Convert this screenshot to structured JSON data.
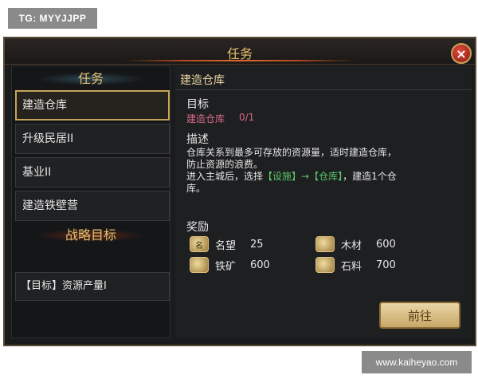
{
  "watermarks": {
    "top": "TG: MYYJJPP",
    "bottom": "www.kaiheyao.com"
  },
  "window": {
    "title": "任务",
    "close_label": "×"
  },
  "left": {
    "tasks_header": "任务",
    "tasks": [
      "建造仓库",
      "升级民居II",
      "基业II",
      "建造铁壁营"
    ],
    "strategy_header": "战略目标",
    "strategy_item": "【目标】资源产量I"
  },
  "detail": {
    "title": "建造仓库",
    "objective_label": "目标",
    "objective_name": "建造仓库",
    "objective_progress": "0/1",
    "description_label": "描述",
    "description_line1": "仓库关系到最多可存放的资源量，适时建造仓库，",
    "description_line2": "防止资源的浪费。",
    "description_line3_pre": "进入主城后，选择",
    "description_link1": "【设施】→【仓库】",
    "description_line3_post": "，建造1个仓",
    "description_line4": "库。",
    "reward_label": "奖励",
    "rewards": [
      {
        "name": "名望",
        "value": "25",
        "icon": "prestige-icon",
        "glyph": "名"
      },
      {
        "name": "木材",
        "value": "600",
        "icon": "wood-icon",
        "glyph": ""
      },
      {
        "name": "铁矿",
        "value": "600",
        "icon": "iron-icon",
        "glyph": ""
      },
      {
        "name": "石料",
        "value": "700",
        "icon": "stone-icon",
        "glyph": ""
      }
    ],
    "go_button": "前往"
  },
  "colors": {
    "accent": "#e8c070",
    "objective": "#d86a86",
    "highlight": "#5ac86a"
  }
}
